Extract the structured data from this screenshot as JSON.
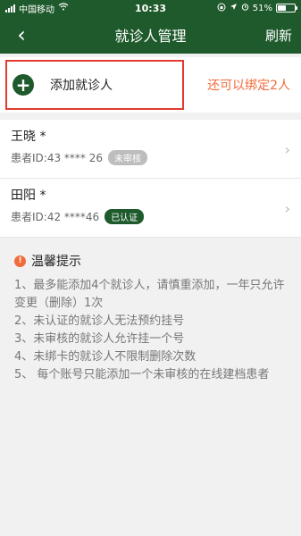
{
  "status_bar": {
    "carrier": "中国移动",
    "time": "10:33",
    "battery_text": "51%",
    "battery_level": 0.51
  },
  "nav": {
    "back_icon": "‹",
    "title": "就诊人管理",
    "refresh_label": "刷新"
  },
  "add_patient": {
    "label": "添加就诊人",
    "remaining_text": "还可以绑定2人"
  },
  "patients": [
    {
      "name": "王晓 *",
      "id_text": "患者ID:43 **** 26",
      "status": "未审核"
    },
    {
      "name": "田阳 *",
      "id_text": "患者ID:42 ****46",
      "status": "已认证"
    }
  ],
  "tips": {
    "title": "温馨提示",
    "items": [
      "1、最多能添加4个就诊人，请慎重添加，一年只允许变更（删除）1次",
      "2、未认证的就诊人无法预约挂号",
      "3、未审核的就诊人允许挂一个号",
      "4、未绑卡的就诊人不限制删除次数",
      "5、 每个账号只能添加一个未审核的在线建档患者"
    ]
  },
  "colors": {
    "primary_green": "#1f5a2c",
    "accent_orange": "#f26b3a",
    "highlight_red": "#e23b2e"
  }
}
